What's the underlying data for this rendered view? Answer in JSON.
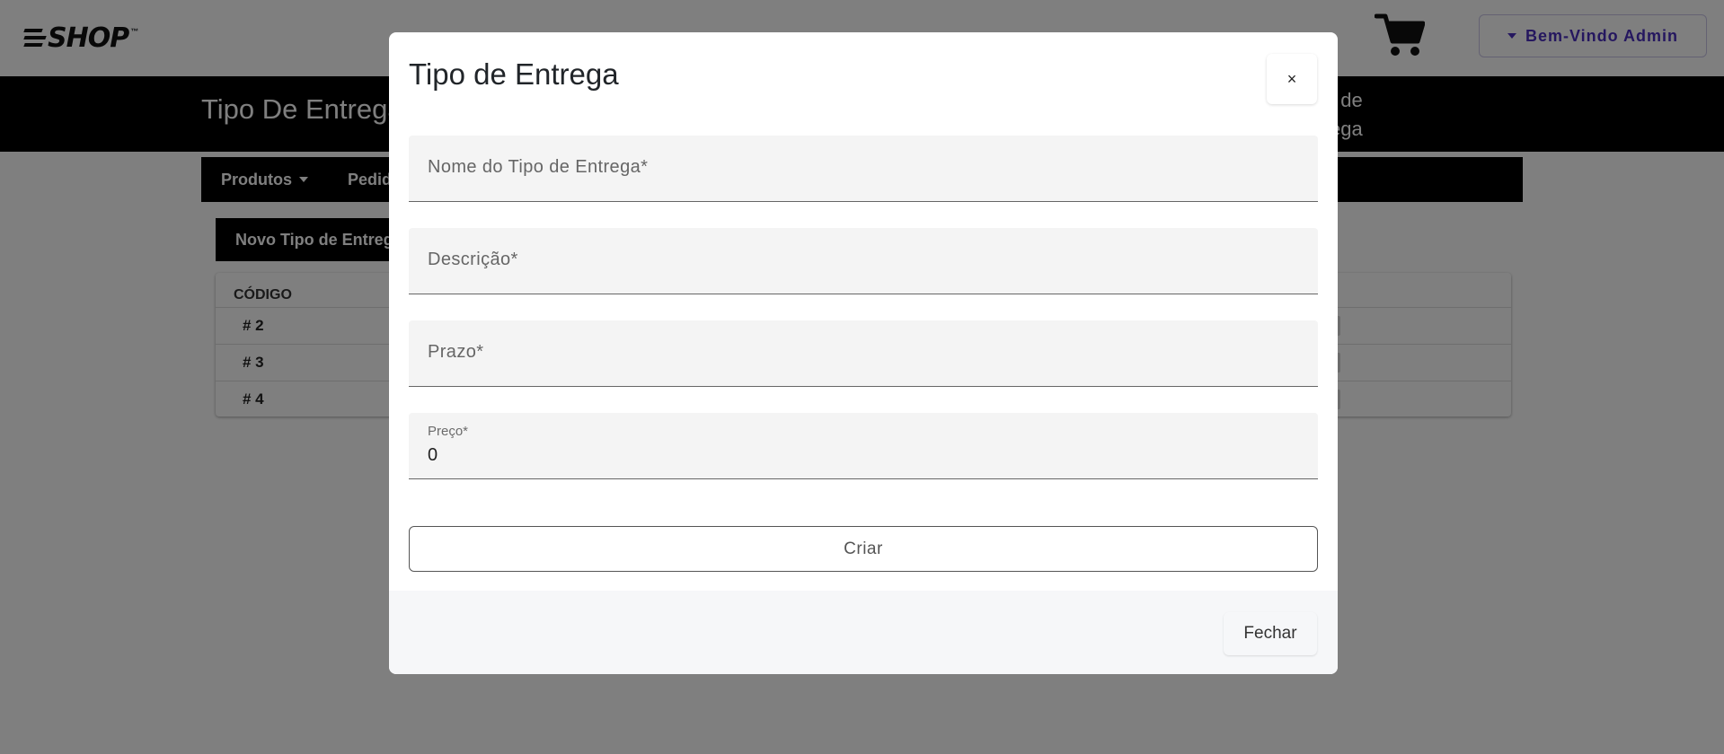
{
  "header": {
    "logo_text": "SHOP",
    "logo_tm": "™",
    "user_menu_label": "Bem-Vindo Admin"
  },
  "page": {
    "title": "Tipo De Entrega",
    "right_title_line1": "de",
    "right_title_line2": "ega"
  },
  "nav": {
    "produtos": "Produtos",
    "pedidos": "Pedidos"
  },
  "new_button_label": "Novo Tipo de Entrega",
  "table": {
    "column_codigo": "CÓDIGO",
    "rows": [
      "# 2",
      "# 3",
      "# 4"
    ]
  },
  "modal": {
    "title": "Tipo de Entrega",
    "close_symbol": "×",
    "fields": {
      "nome_placeholder": "Nome do Tipo de Entrega*",
      "descricao_placeholder": "Descrição*",
      "prazo_placeholder": "Prazo*",
      "preco_label": "Preço*",
      "preco_value": "0"
    },
    "create_label": "Criar",
    "close_label": "Fechar"
  },
  "colors": {
    "accent": "#4b2fbf",
    "overlay": "rgba(0,0,0,0.5)"
  }
}
